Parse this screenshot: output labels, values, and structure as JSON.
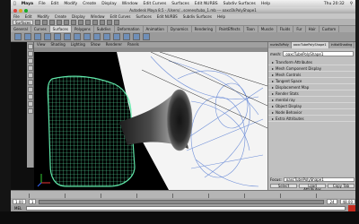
{
  "menubar": {
    "apple": "",
    "items": [
      "Maya",
      "File",
      "Edit",
      "Modify",
      "Create",
      "Display",
      "Window",
      "Edit Curves",
      "Surfaces",
      "Edit NURBS",
      "Subdiv Surfaces",
      "Help"
    ],
    "clock": "Thu 20:32"
  },
  "window": {
    "title": "Autodesk Maya 8.5 - /Users/...scenes/tuba_1.mb --- oaxcOkPolyShape1"
  },
  "maya_menu": [
    "File",
    "Edit",
    "Modify",
    "Create",
    "Display",
    "Window",
    "Edit Curves",
    "Surfaces",
    "Edit NURBS",
    "Subdiv Surfaces",
    "Help"
  ],
  "status": {
    "mode": "Surfaces"
  },
  "shelf_tabs": [
    "General",
    "Curves",
    "Surfaces",
    "Polygons",
    "Subdivs",
    "Deformation",
    "Animation",
    "Dynamics",
    "Rendering",
    "PaintEffects",
    "Toon",
    "Muscle",
    "Fluids",
    "Fur",
    "Hair",
    "Custom"
  ],
  "viewport_menu": [
    "View",
    "Shading",
    "Lighting",
    "Show",
    "Renderer",
    "Panels"
  ],
  "channel_box": {
    "tabs": [
      "nurbsToPoly",
      "oaxcTubePolyShape1",
      "initialShading"
    ],
    "node_label": "mesh:",
    "node_value": "oaxcTubePolyShape1",
    "sections": [
      "Transform Attributes",
      "Mesh Component Display",
      "Mesh Controls",
      "Tangent Space",
      "Displacement Map",
      "Render Stats",
      "mental ray",
      "Object Display",
      "Node Behavior",
      "Extra Attributes"
    ],
    "focus_label": "Focus:",
    "focus_value": "oaxcTubePolyShape1",
    "select_button": "Select",
    "load_button": "Load Attributes",
    "copy_button": "Copy Tab"
  },
  "timeline": {
    "start": "1",
    "end": "24"
  },
  "range": {
    "start": "1.00",
    "end": "48.00"
  },
  "cmd": {
    "label": "MEL"
  },
  "colors": {
    "wire": "#5fe6a8",
    "mesh_dark": "#2a2a2a",
    "bg_white": "#f4f4f4"
  }
}
